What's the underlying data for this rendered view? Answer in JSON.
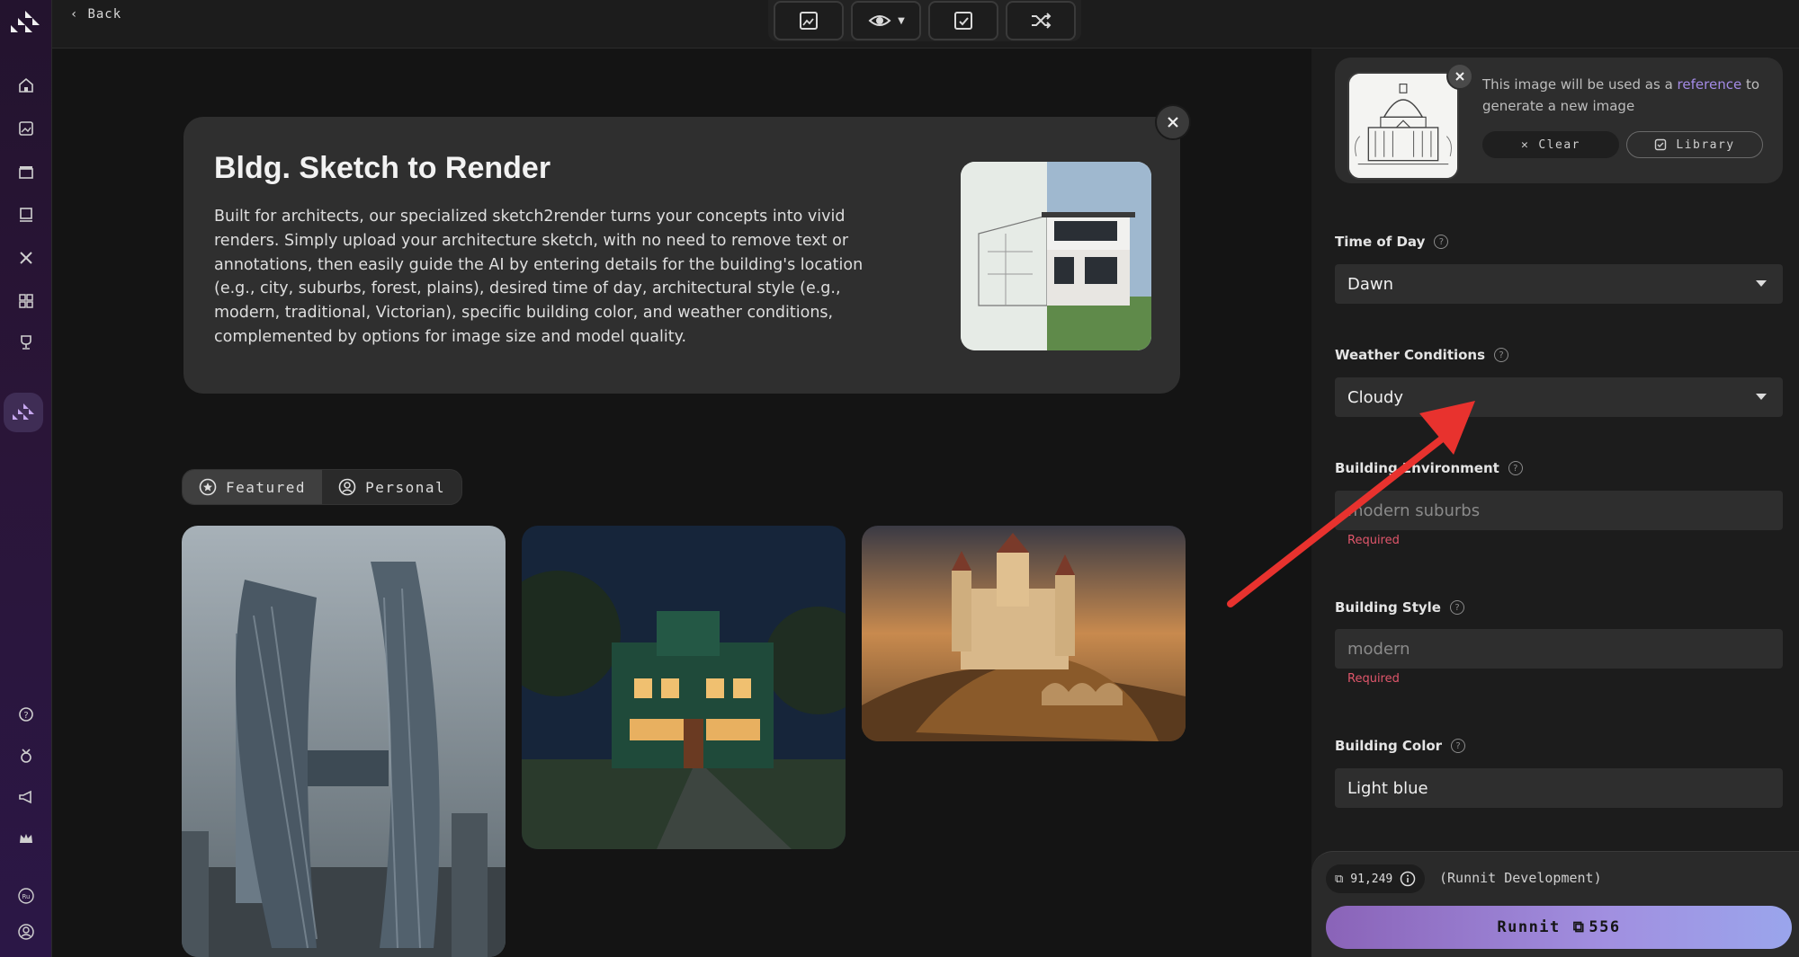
{
  "topbar": {
    "back_label": "Back"
  },
  "hero": {
    "title": "Bldg. Sketch to Render",
    "description": "Built for architects, our specialized sketch2render turns your concepts into vivid renders. Simply upload your architecture sketch, with no need to remove text or annotations, then easily guide the AI by entering details for the building's location (e.g., city, suburbs, forest, plains), desired time of day, architectural style (e.g., modern, traditional, Victorian), specific building color, and weather conditions, complemented by options for image size and model quality."
  },
  "tabs": [
    {
      "label": "Featured",
      "icon": "star-icon",
      "active": true
    },
    {
      "label": "Personal",
      "icon": "user-icon",
      "active": false
    }
  ],
  "reference": {
    "text_before": "This image will be used as a ",
    "link": "reference",
    "text_after": " to generate a new image",
    "clear_label": "Clear",
    "library_label": "Library"
  },
  "form": {
    "time_of_day": {
      "label": "Time of Day",
      "value": "Dawn"
    },
    "weather": {
      "label": "Weather Conditions",
      "value": "Cloudy"
    },
    "environment": {
      "label": "Building Environment",
      "placeholder": "modern suburbs",
      "required": "Required"
    },
    "style": {
      "label": "Building Style",
      "placeholder": "modern",
      "required": "Required"
    },
    "color": {
      "label": "Building Color",
      "value": "Light blue"
    }
  },
  "footer": {
    "credits": "91,249",
    "environment": "(Runnit Development)",
    "run_label": "Runnit",
    "run_cost": "556"
  },
  "colors": {
    "accent": "#a48be6",
    "required": "#e0566b",
    "annotation_arrow": "#e8322e"
  }
}
